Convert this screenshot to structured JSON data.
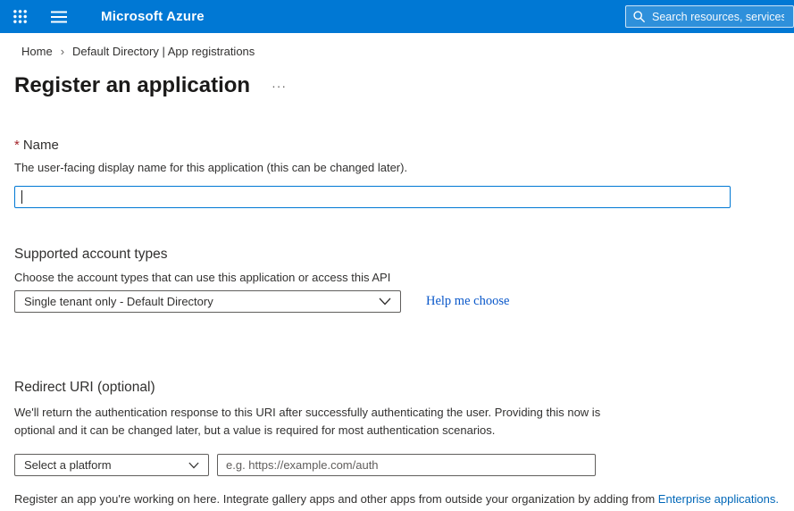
{
  "theme": {
    "topbar_color": "#0078d4",
    "link_color": "#0067b8",
    "required_color": "#a4262c",
    "focus_border_color": "#0078d4"
  },
  "topbar": {
    "title": "Microsoft Azure",
    "search": {
      "placeholder": "Search resources, services, a",
      "value": ""
    }
  },
  "breadcrumb": {
    "home": "Home",
    "separator": "›",
    "current": "Default Directory | App registrations"
  },
  "page": {
    "title": "Register an application",
    "menu_ellipsis": "···"
  },
  "form": {
    "name": {
      "required_marker": "*",
      "label": "Name",
      "description": "The user-facing display name for this application (this can be changed later).",
      "value": ""
    },
    "account_types": {
      "heading": "Supported account types",
      "description": "Choose the account types that can use this application or access this API",
      "selected": "Single tenant only - Default Directory",
      "help_link": "Help me choose"
    },
    "redirect_uri": {
      "heading": "Redirect URI (optional)",
      "description": "We'll return the authentication response to this URI after successfully authenticating the user. Providing this now is optional and it can be changed later, but a value is required for most authentication scenarios.",
      "platform_selected": "Select a platform",
      "uri_placeholder": "e.g. https://example.com/auth",
      "uri_value": ""
    }
  },
  "footer": {
    "text": "Register an app you're working on here. Integrate gallery apps and other apps from outside your organization by adding from ",
    "link": "Enterprise applications."
  }
}
